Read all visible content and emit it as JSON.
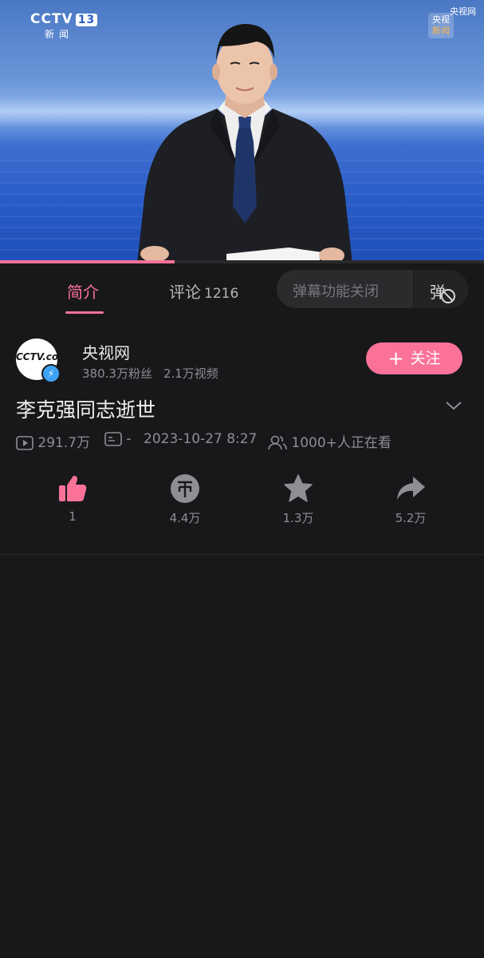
{
  "video": {
    "channel_logo": "CCTV",
    "channel_number": "13",
    "channel_sub": "新闻",
    "watermark": "央视网",
    "badge_line1": "央视",
    "badge_line2": "新闻",
    "progress_fraction": 0.36
  },
  "tabs": {
    "intro": "简介",
    "comments": "评论",
    "comments_count": "1216"
  },
  "danmu": {
    "placeholder": "弹幕功能关闭",
    "toggle_char": "弹"
  },
  "uploader": {
    "avatar_text": "CCTV.com",
    "name": "央视网",
    "followers": "380.3万粉丝",
    "videos": "2.1万视频",
    "follow_label": "关注"
  },
  "title": "李克强同志逝世",
  "meta": {
    "plays": "291.7万",
    "danmaku": "-",
    "datetime": "2023-10-27 8:27",
    "watching": "1000+人正在看"
  },
  "actions": [
    {
      "name": "like",
      "label": "1",
      "icon": "thumbs-up-icon",
      "color": "#fb7299"
    },
    {
      "name": "coin",
      "label": "4.4万",
      "icon": "coin-icon",
      "color": "#8e8e93"
    },
    {
      "name": "favorite",
      "label": "1.3万",
      "icon": "star-icon",
      "color": "#8e8e93"
    },
    {
      "name": "share",
      "label": "5.2万",
      "icon": "share-icon",
      "color": "#8e8e93"
    }
  ],
  "colors": {
    "accent": "#fb7299",
    "background": "#18181a",
    "muted": "#8e8e93"
  }
}
